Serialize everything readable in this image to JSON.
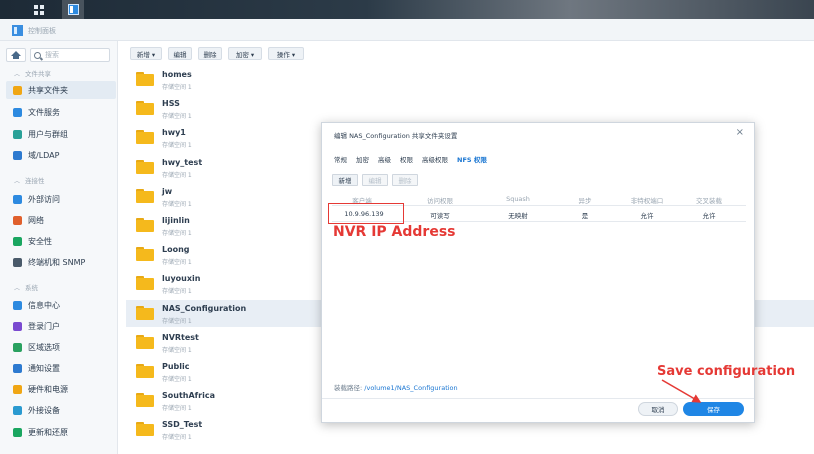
{
  "window": {
    "title": "控制面板"
  },
  "sidebar": {
    "search_placeholder": "搜索",
    "sections": [
      {
        "label": "文件共享"
      },
      {
        "label": "连接性"
      },
      {
        "label": "系统"
      }
    ],
    "items": [
      {
        "label": "共享文件夹",
        "color": "#f0a614"
      },
      {
        "label": "文件服务",
        "color": "#2d8ae0"
      },
      {
        "label": "用户与群组",
        "color": "#2aa198"
      },
      {
        "label": "域/LDAP",
        "color": "#2d7ad0"
      },
      {
        "label": "外部访问",
        "color": "#2d8ae0"
      },
      {
        "label": "网络",
        "color": "#e0602d"
      },
      {
        "label": "安全性",
        "color": "#1aa660"
      },
      {
        "label": "终端机和 SNMP",
        "color": "#4a5a6a"
      },
      {
        "label": "信息中心",
        "color": "#2d8ae0"
      },
      {
        "label": "登录门户",
        "color": "#7a4ad0"
      },
      {
        "label": "区域选项",
        "color": "#2aa160"
      },
      {
        "label": "通知设置",
        "color": "#2d7ad0"
      },
      {
        "label": "硬件和电源",
        "color": "#f0a614"
      },
      {
        "label": "外接设备",
        "color": "#2a9ad0"
      },
      {
        "label": "更新和还原",
        "color": "#1aa660"
      }
    ]
  },
  "toolbar": {
    "create": "新增 ▾",
    "edit": "编辑",
    "delete": "删除",
    "encrypt": "加密 ▾",
    "action": "操作 ▾"
  },
  "files": [
    {
      "name": "homes",
      "sub": "存储空间 1"
    },
    {
      "name": "HSS",
      "sub": "存储空间 1"
    },
    {
      "name": "hwy1",
      "sub": "存储空间 1"
    },
    {
      "name": "hwy_test",
      "sub": "存储空间 1"
    },
    {
      "name": "jw",
      "sub": "存储空间 1"
    },
    {
      "name": "lijinlin",
      "sub": "存储空间 1"
    },
    {
      "name": "Loong",
      "sub": "存储空间 1"
    },
    {
      "name": "luyouxin",
      "sub": "存储空间 1"
    },
    {
      "name": "NAS_Configuration",
      "sub": "存储空间 1"
    },
    {
      "name": "NVRtest",
      "sub": "存储空间 1"
    },
    {
      "name": "Public",
      "sub": "存储空间 1"
    },
    {
      "name": "SouthAfrica",
      "sub": "存储空间 1"
    },
    {
      "name": "SSD_Test",
      "sub": "存储空间 1"
    }
  ],
  "dialog": {
    "title": "编辑 NAS_Configuration 共享文件夹设置",
    "close": "×",
    "tabs": [
      "常规",
      "加密",
      "高级",
      "权限",
      "高级权限",
      "NFS 权限"
    ],
    "buttons": {
      "create": "新增",
      "edit": "编辑",
      "delete": "删除"
    },
    "headers": [
      "客户端",
      "访问权限",
      "Squash",
      "异步",
      "非特权端口",
      "交叉装载"
    ],
    "row": [
      "10.9.96.139",
      "可读写",
      "无映射",
      "是",
      "允许",
      "允许"
    ],
    "path_label": "装载路径:",
    "path_value": "/volume1/NAS_Configuration",
    "cancel": "取消",
    "save": "保存"
  },
  "annotations": {
    "nvr": "NVR IP Address",
    "save": "Save configuration",
    "color": "#e53935"
  }
}
